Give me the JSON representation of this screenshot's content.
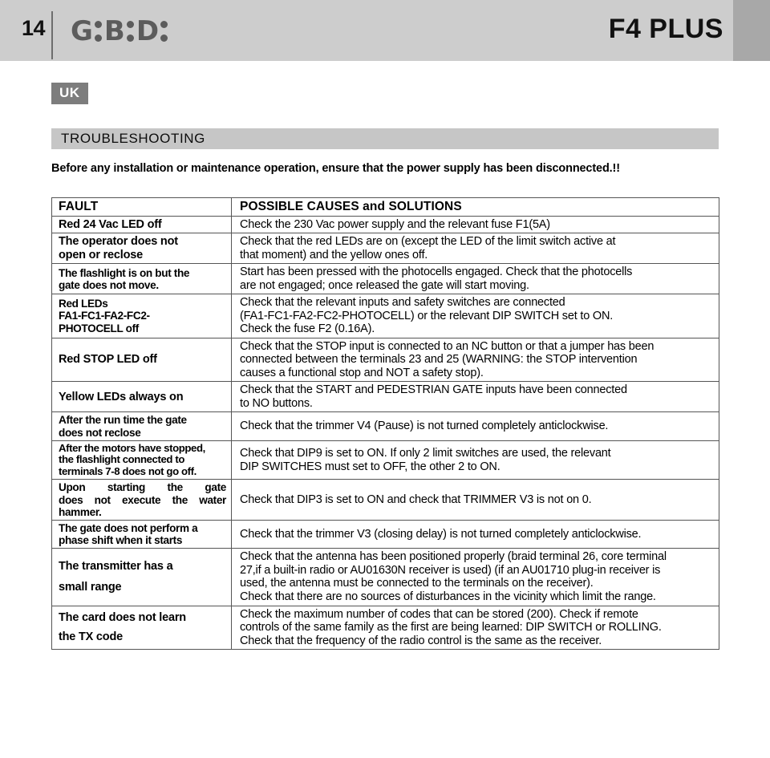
{
  "header": {
    "page_number": "14",
    "brand": {
      "letters": [
        "G",
        "B",
        "D"
      ],
      "rendered": "G:B:D:"
    },
    "product_title": "F4 PLUS",
    "band_color": "#cdcdcd",
    "band_right_strip_color": "#a8a8a8",
    "brand_color": "#5c5c5c"
  },
  "language_badge": {
    "label": "UK",
    "background": "#7d7d7d",
    "color": "#ffffff"
  },
  "section": {
    "title": "TROUBLESHOOTING",
    "bar_color": "#c6c6c6"
  },
  "warning": "Before any installation or maintenance operation, ensure that the power supply has been disconnected.!!",
  "table": {
    "columns": [
      "FAULT",
      "POSSIBLE CAUSES and SOLUTIONS"
    ],
    "rows": [
      {
        "fault": "Red 24 Vac LED off",
        "fault_lines": [
          "Red 24 Vac LED off"
        ],
        "solution_lines": [
          "Check the 230 Vac power supply and the relevant fuse F1(5A)"
        ]
      },
      {
        "fault": "The operator does not open or reclose",
        "fault_lines": [
          "The operator does not",
          "open or reclose"
        ],
        "solution_lines": [
          "Check that the red LEDs are on (except the LED of the limit switch active at",
          "that moment) and the yellow ones off."
        ]
      },
      {
        "fault": "The flashlight is on but the gate does not move.",
        "fault_lines": [
          "The flashlight is on but the",
          "gate does not move."
        ],
        "solution_lines": [
          "Start has been pressed with the photocells engaged. Check that the photocells",
          "are not engaged; once released the gate will start moving."
        ]
      },
      {
        "fault": "Red LEDs FA1-FC1-FA2-FC2-PHOTOCELL off",
        "fault_lines": [
          "Red LEDs",
          "FA1-FC1-FA2-FC2-",
          "PHOTOCELL off"
        ],
        "solution_lines": [
          "Check that the relevant inputs and safety switches are connected",
          "(FA1-FC1-FA2-FC2-PHOTOCELL) or the relevant DIP SWITCH set to ON.",
          "Check the fuse F2 (0.16A)."
        ]
      },
      {
        "fault": "Red STOP LED off",
        "fault_lines": [
          "Red STOP LED off"
        ],
        "solution_lines": [
          "Check that the STOP input is connected to an NC button or that a jumper has been",
          "connected between the terminals 23 and 25 (WARNING: the STOP intervention",
          "causes a functional stop and NOT a safety stop)."
        ]
      },
      {
        "fault": "Yellow LEDs always on",
        "fault_lines": [
          "Yellow LEDs always on"
        ],
        "solution_lines": [
          "Check that the START and PEDESTRIAN GATE inputs have been connected",
          "to NO buttons."
        ]
      },
      {
        "fault": "After the run time the gate does not reclose",
        "fault_lines": [
          "After the run time the gate",
          "does not reclose"
        ],
        "solution_lines": [
          "Check that the trimmer V4 (Pause) is not turned completely anticlockwise."
        ]
      },
      {
        "fault": "After the motors have stopped, the flashlight connected to terminals 7-8 does not go off.",
        "fault_lines": [
          "After the motors have stopped,",
          "the flashlight connected to",
          "terminals 7-8 does not go off."
        ],
        "solution_lines": [
          "Check that DIP9 is set to ON. If only 2 limit switches are used, the relevant",
          "DIP SWITCHES must set to OFF, the other 2 to ON."
        ]
      },
      {
        "fault": "Upon starting the gate does not execute the water hammer.",
        "fault_lines": [
          "Upon starting the gate",
          "does not execute the water",
          "hammer."
        ],
        "solution_lines": [
          "Check that DIP3 is set to ON and check  that TRIMMER V3 is not on 0."
        ]
      },
      {
        "fault": "The gate does not perform a phase shift when it starts",
        "fault_lines": [
          "The gate does not perform a",
          "phase shift when it starts"
        ],
        "solution_lines": [
          "Check that the trimmer V3 (closing delay) is not turned completely anticlockwise."
        ]
      },
      {
        "fault": "The transmitter has a small range",
        "fault_lines": [
          "The transmitter has a",
          "small range"
        ],
        "solution_lines": [
          "Check that the antenna has been positioned properly (braid terminal 26, core terminal",
          "27,if a built-in radio or AU01630N receiver is used) (if an AU01710 plug-in receiver is",
          "used, the antenna must be connected to the terminals on the receiver).",
          "Check that there are no sources of disturbances in the vicinity which limit the range."
        ]
      },
      {
        "fault": "The card does not learn the TX code",
        "fault_lines": [
          "The card does not learn",
          "the TX code"
        ],
        "solution_lines": [
          "Check the maximum number of codes that can be stored (200).  Check if remote",
          "controls of the same family as the first are being learned: DIP SWITCH or ROLLING.",
          "Check that the frequency of the radio control is the same as the receiver."
        ]
      }
    ]
  }
}
